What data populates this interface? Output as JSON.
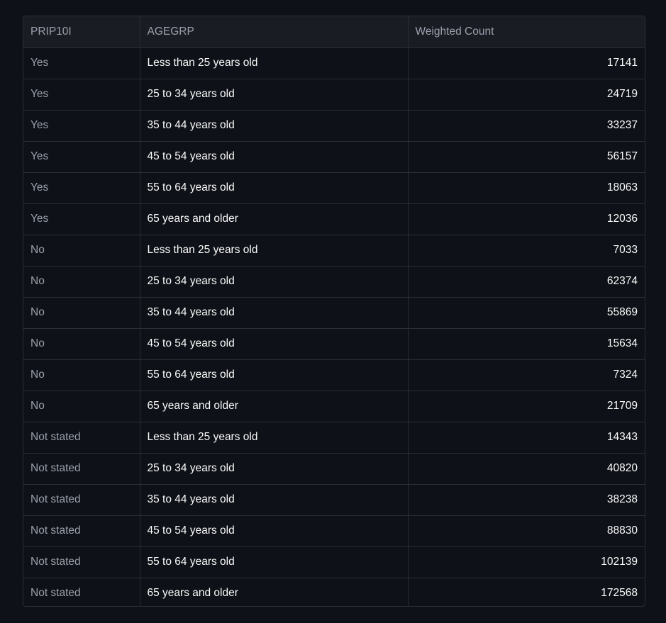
{
  "table": {
    "columns": [
      "PRIP10I",
      "AGEGRP",
      "Weighted Count"
    ],
    "rows": [
      {
        "prip10i": "Yes",
        "agegrp": "Less than 25 years old",
        "weighted_count": "17141"
      },
      {
        "prip10i": "Yes",
        "agegrp": "25 to 34 years old",
        "weighted_count": "24719"
      },
      {
        "prip10i": "Yes",
        "agegrp": "35 to 44 years old",
        "weighted_count": "33237"
      },
      {
        "prip10i": "Yes",
        "agegrp": "45 to 54 years old",
        "weighted_count": "56157"
      },
      {
        "prip10i": "Yes",
        "agegrp": "55 to 64 years old",
        "weighted_count": "18063"
      },
      {
        "prip10i": "Yes",
        "agegrp": "65 years and older",
        "weighted_count": "12036"
      },
      {
        "prip10i": "No",
        "agegrp": "Less than 25 years old",
        "weighted_count": "7033"
      },
      {
        "prip10i": "No",
        "agegrp": "25 to 34 years old",
        "weighted_count": "62374"
      },
      {
        "prip10i": "No",
        "agegrp": "35 to 44 years old",
        "weighted_count": "55869"
      },
      {
        "prip10i": "No",
        "agegrp": "45 to 54 years old",
        "weighted_count": "15634"
      },
      {
        "prip10i": "No",
        "agegrp": "55 to 64 years old",
        "weighted_count": "7324"
      },
      {
        "prip10i": "No",
        "agegrp": "65 years and older",
        "weighted_count": "21709"
      },
      {
        "prip10i": "Not stated",
        "agegrp": "Less than 25 years old",
        "weighted_count": "14343"
      },
      {
        "prip10i": "Not stated",
        "agegrp": "25 to 34 years old",
        "weighted_count": "40820"
      },
      {
        "prip10i": "Not stated",
        "agegrp": "35 to 44 years old",
        "weighted_count": "38238"
      },
      {
        "prip10i": "Not stated",
        "agegrp": "45 to 54 years old",
        "weighted_count": "88830"
      },
      {
        "prip10i": "Not stated",
        "agegrp": "55 to 64 years old",
        "weighted_count": "102139"
      },
      {
        "prip10i": "Not stated",
        "agegrp": "65 years and older",
        "weighted_count": "172568"
      }
    ]
  },
  "colors": {
    "background": "#0e1117",
    "header_background": "#1a1c24",
    "border": "#2b2e36",
    "muted_text": "#9aa0ab",
    "text": "#fafafa"
  }
}
